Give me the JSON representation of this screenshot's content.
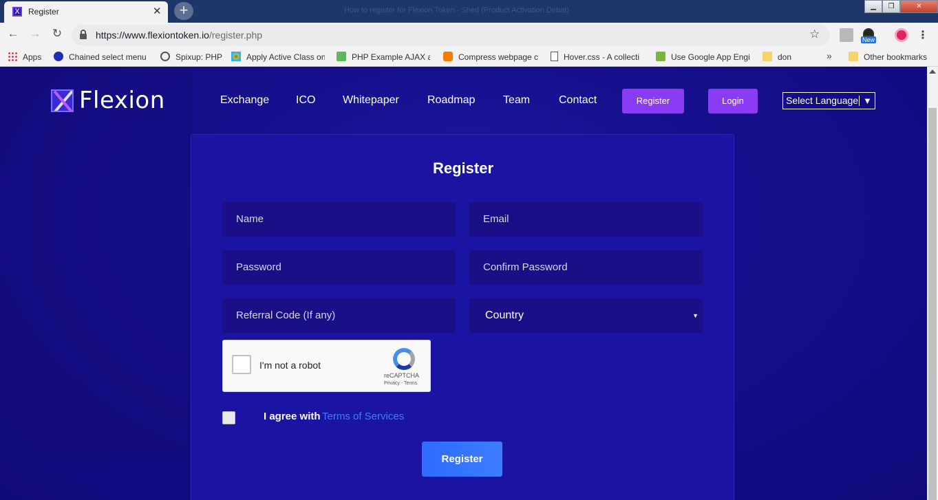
{
  "browser": {
    "tab_title": "Register",
    "window_title": "How to register for Flexion Token - Shed (Product Activation Debat)",
    "url_host": "https://www.flexiontoken.io",
    "url_path": "/register.php",
    "ext_new_badge": "New",
    "bookmarks": [
      {
        "label": "Apps",
        "icon": "apps-grid-icon"
      },
      {
        "label": "Chained select menu",
        "icon": "d-logo-icon"
      },
      {
        "label": "Spixup: PHP",
        "icon": "spixup-icon"
      },
      {
        "label": "Apply Active Class on",
        "icon": "gear-flower-icon"
      },
      {
        "label": "PHP Example AJAX an",
        "icon": "php-icon"
      },
      {
        "label": "Compress webpage c",
        "icon": "blogger-icon"
      },
      {
        "label": "Hover.css - A collecti",
        "icon": "page-icon"
      },
      {
        "label": "Use Google App Engi",
        "icon": "lh-icon"
      },
      {
        "label": "don",
        "icon": "folder-icon"
      },
      {
        "label": "Other bookmarks",
        "icon": "folder-icon"
      }
    ],
    "bookmark_overflow": "»"
  },
  "site": {
    "logo_text": "Flexion",
    "nav": [
      "Exchange",
      "ICO",
      "Whitepaper",
      "Roadmap",
      "Team",
      "Contact"
    ],
    "register_btn": "Register",
    "login_btn": "Login",
    "language": "Select Language",
    "language_arrow": "▼"
  },
  "form": {
    "title": "Register",
    "name_placeholder": "Name",
    "email_placeholder": "Email",
    "password_placeholder": "Password",
    "confirm_placeholder": "Confirm Password",
    "referral_placeholder": "Referral Code (If any)",
    "country_value": "Country",
    "captcha_label": "I'm not a robot",
    "captcha_brand": "reCAPTCHA",
    "captcha_links": "Privacy - Terms",
    "agree_text": "I agree with",
    "agree_link": "Terms of Services",
    "submit": "Register"
  },
  "colors": {
    "page_bg": "#150f8c",
    "card_bg": "#1b14a3",
    "input_bg": "#1a0f87",
    "nav_button": "#8a3cf5",
    "submit_button": "#3572ff",
    "link": "#3d7bff"
  }
}
